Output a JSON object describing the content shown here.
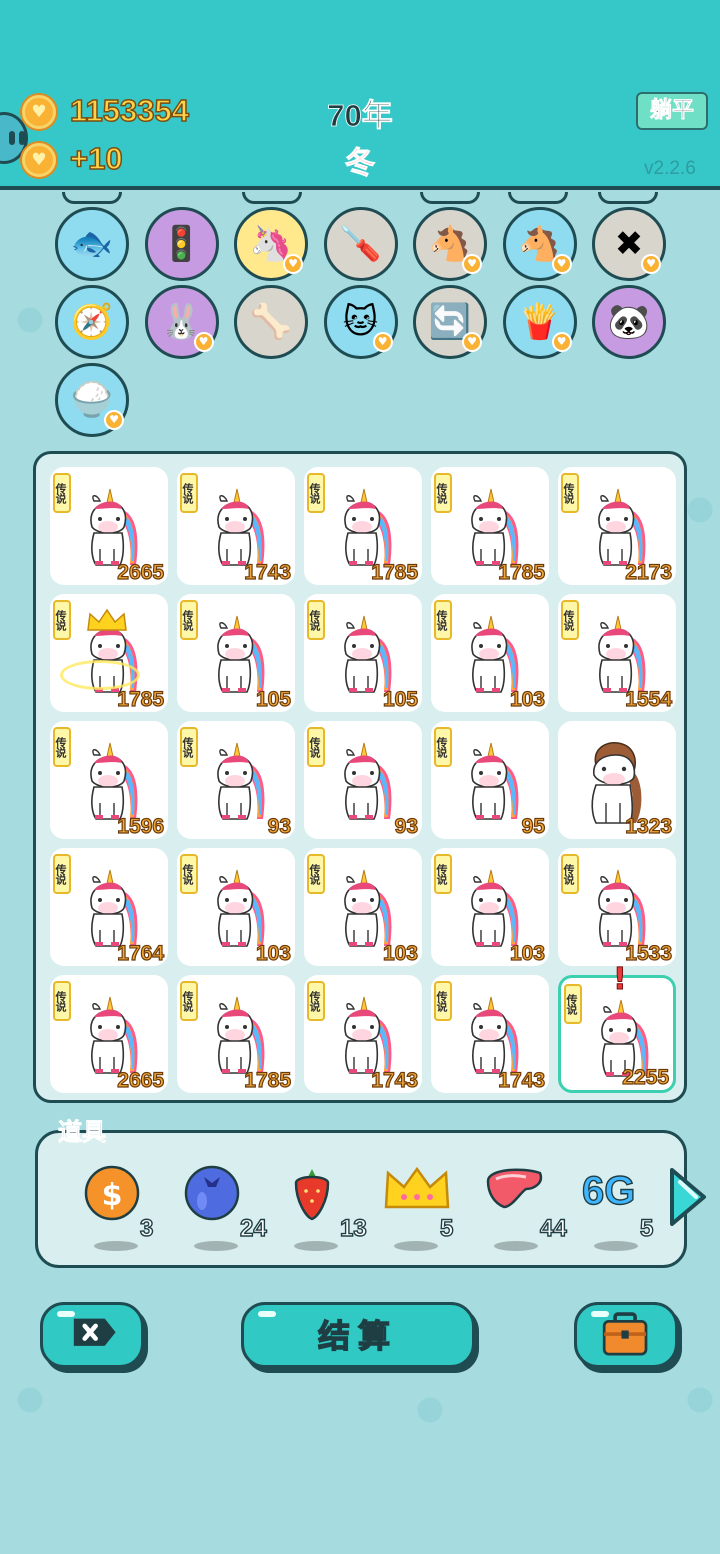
{
  "header": {
    "coins": "1153354",
    "income": "+10",
    "year": "70年",
    "season": "冬",
    "lie_flat_label": "躺平",
    "version": "v2.2.6"
  },
  "owned_items": [
    {
      "icon": "fishbowl-icon",
      "glyph": "🐟",
      "bg": "cyan",
      "heart": false
    },
    {
      "icon": "traffic-light-ghost-icon",
      "glyph": "🚦",
      "bg": "purple",
      "heart": false
    },
    {
      "icon": "unicorn-icon",
      "glyph": "🦄",
      "bg": "yellow",
      "heart": true
    },
    {
      "icon": "screwdriver-icon",
      "glyph": "🪛",
      "bg": "gray",
      "heart": false
    },
    {
      "icon": "pony-pair-icon",
      "glyph": "🐴",
      "bg": "gray",
      "heart": true
    },
    {
      "icon": "pony-pair-icon",
      "glyph": "🐴",
      "bg": "cyan",
      "heart": true
    },
    {
      "icon": "delete-tag-icon",
      "glyph": "✖",
      "bg": "gray",
      "heart": true
    },
    {
      "icon": "compass-icon",
      "glyph": "🧭",
      "bg": "cyan",
      "heart": false
    },
    {
      "icon": "rabbit-icon",
      "glyph": "🐰",
      "bg": "purple",
      "heart": true
    },
    {
      "icon": "pet-food-bowl-icon",
      "glyph": "🦴",
      "bg": "gray",
      "heart": false
    },
    {
      "icon": "cat-icon",
      "glyph": "🐱",
      "bg": "cyan",
      "heart": true
    },
    {
      "icon": "refresh-icon",
      "glyph": "🔄",
      "bg": "gray",
      "heart": true
    },
    {
      "icon": "fries-icon",
      "glyph": "🍟",
      "bg": "cyan",
      "heart": true
    },
    {
      "icon": "panda-icon",
      "glyph": "🐼",
      "bg": "purple",
      "heart": false
    },
    {
      "icon": "rice-bowl-icon",
      "glyph": "🍚",
      "bg": "cyan",
      "heart": true
    }
  ],
  "board": {
    "tag_label": "传说",
    "cells": [
      {
        "kind": "unicorn",
        "count": "2665"
      },
      {
        "kind": "unicorn",
        "count": "1743"
      },
      {
        "kind": "unicorn",
        "count": "1785"
      },
      {
        "kind": "unicorn",
        "count": "1785"
      },
      {
        "kind": "unicorn",
        "count": "2173"
      },
      {
        "kind": "unicorn",
        "count": "1785",
        "crown": true
      },
      {
        "kind": "unicorn",
        "count": "105"
      },
      {
        "kind": "unicorn",
        "count": "105"
      },
      {
        "kind": "unicorn",
        "count": "103"
      },
      {
        "kind": "unicorn",
        "count": "1554"
      },
      {
        "kind": "unicorn",
        "count": "1596"
      },
      {
        "kind": "unicorn",
        "count": "93"
      },
      {
        "kind": "unicorn",
        "count": "93"
      },
      {
        "kind": "unicorn",
        "count": "95"
      },
      {
        "kind": "pony",
        "count": "1323"
      },
      {
        "kind": "unicorn",
        "count": "1764"
      },
      {
        "kind": "unicorn",
        "count": "103"
      },
      {
        "kind": "unicorn",
        "count": "103"
      },
      {
        "kind": "unicorn",
        "count": "103"
      },
      {
        "kind": "unicorn",
        "count": "1533"
      },
      {
        "kind": "unicorn",
        "count": "2665"
      },
      {
        "kind": "unicorn",
        "count": "1785"
      },
      {
        "kind": "unicorn",
        "count": "1743"
      },
      {
        "kind": "unicorn",
        "count": "1743"
      },
      {
        "kind": "unicorn",
        "count": "2255",
        "selected": true,
        "alert": "!"
      }
    ]
  },
  "props": {
    "title": "道具",
    "items": [
      {
        "icon": "dollar-coin-icon",
        "qty": "3"
      },
      {
        "icon": "blue-berry-icon",
        "qty": "24"
      },
      {
        "icon": "strawberry-icon",
        "qty": "13"
      },
      {
        "icon": "crown-icon",
        "qty": "5"
      },
      {
        "icon": "liver-icon",
        "qty": "44"
      },
      {
        "icon": "6g-icon",
        "qty": "5",
        "text": "6G"
      }
    ]
  },
  "buttons": {
    "settle_label": "结算"
  },
  "colors": {
    "header_bg": "#36c8c8",
    "board_bg": "#d9efef",
    "count_text": "#f2a93b",
    "accent_button": "#30c9c3"
  }
}
